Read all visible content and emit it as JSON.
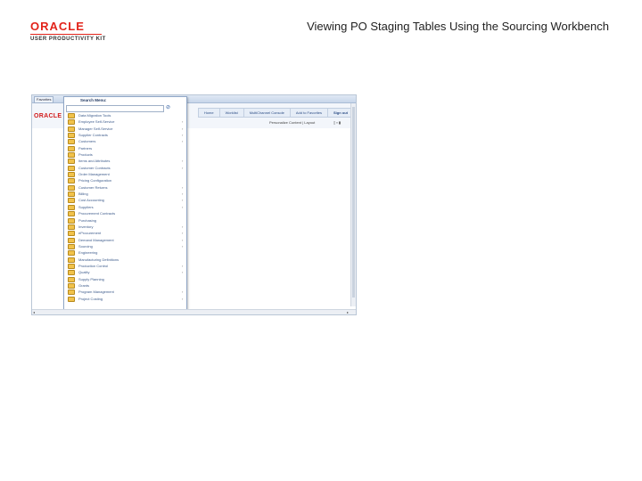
{
  "header": {
    "logo_brand": "ORACLE",
    "logo_tagline": "USER PRODUCTIVITY KIT",
    "title": "Viewing PO Staging Tables Using the Sourcing Workbench"
  },
  "screenshot": {
    "tabs": [
      "Favorites",
      "Main Menu"
    ],
    "brand": "ORACLE",
    "nav_links": [
      "Home",
      "Worklist",
      "MultiChannel Console",
      "Add to Favorites",
      "Sign out"
    ],
    "content_text": "Personalize Content | Layout",
    "menu": {
      "title": "Search Menu:",
      "go_icon": "search-go-icon",
      "items": [
        {
          "label": "Data Migration Tools",
          "has_arrow": false
        },
        {
          "label": "Employee Self-Service",
          "has_arrow": true
        },
        {
          "label": "Manager Self-Service",
          "has_arrow": true
        },
        {
          "label": "Supplier Contracts",
          "has_arrow": true
        },
        {
          "label": "Customers",
          "has_arrow": true
        },
        {
          "label": "Partners",
          "has_arrow": false
        },
        {
          "label": "Products",
          "has_arrow": false
        },
        {
          "label": "Items and Attributes",
          "has_arrow": true
        },
        {
          "label": "Customer Contracts",
          "has_arrow": true
        },
        {
          "label": "Order Management",
          "has_arrow": false
        },
        {
          "label": "Pricing Configuration",
          "has_arrow": false
        },
        {
          "label": "Customer Returns",
          "has_arrow": true
        },
        {
          "label": "Billing",
          "has_arrow": true
        },
        {
          "label": "Cost Accounting",
          "has_arrow": true
        },
        {
          "label": "Suppliers",
          "has_arrow": true
        },
        {
          "label": "Procurement Contracts",
          "has_arrow": false
        },
        {
          "label": "Purchasing",
          "has_arrow": false
        },
        {
          "label": "Inventory",
          "has_arrow": true
        },
        {
          "label": "eProcurement",
          "has_arrow": true
        },
        {
          "label": "Demand Management",
          "has_arrow": true
        },
        {
          "label": "Sourcing",
          "has_arrow": true
        },
        {
          "label": "Engineering",
          "has_arrow": false
        },
        {
          "label": "Manufacturing Definitions",
          "has_arrow": false
        },
        {
          "label": "Production Control",
          "has_arrow": true
        },
        {
          "label": "Quality",
          "has_arrow": true
        },
        {
          "label": "Supply Planning",
          "has_arrow": false
        },
        {
          "label": "Grants",
          "has_arrow": false
        },
        {
          "label": "Program Management",
          "has_arrow": true
        },
        {
          "label": "Project Costing",
          "has_arrow": true
        }
      ]
    }
  }
}
